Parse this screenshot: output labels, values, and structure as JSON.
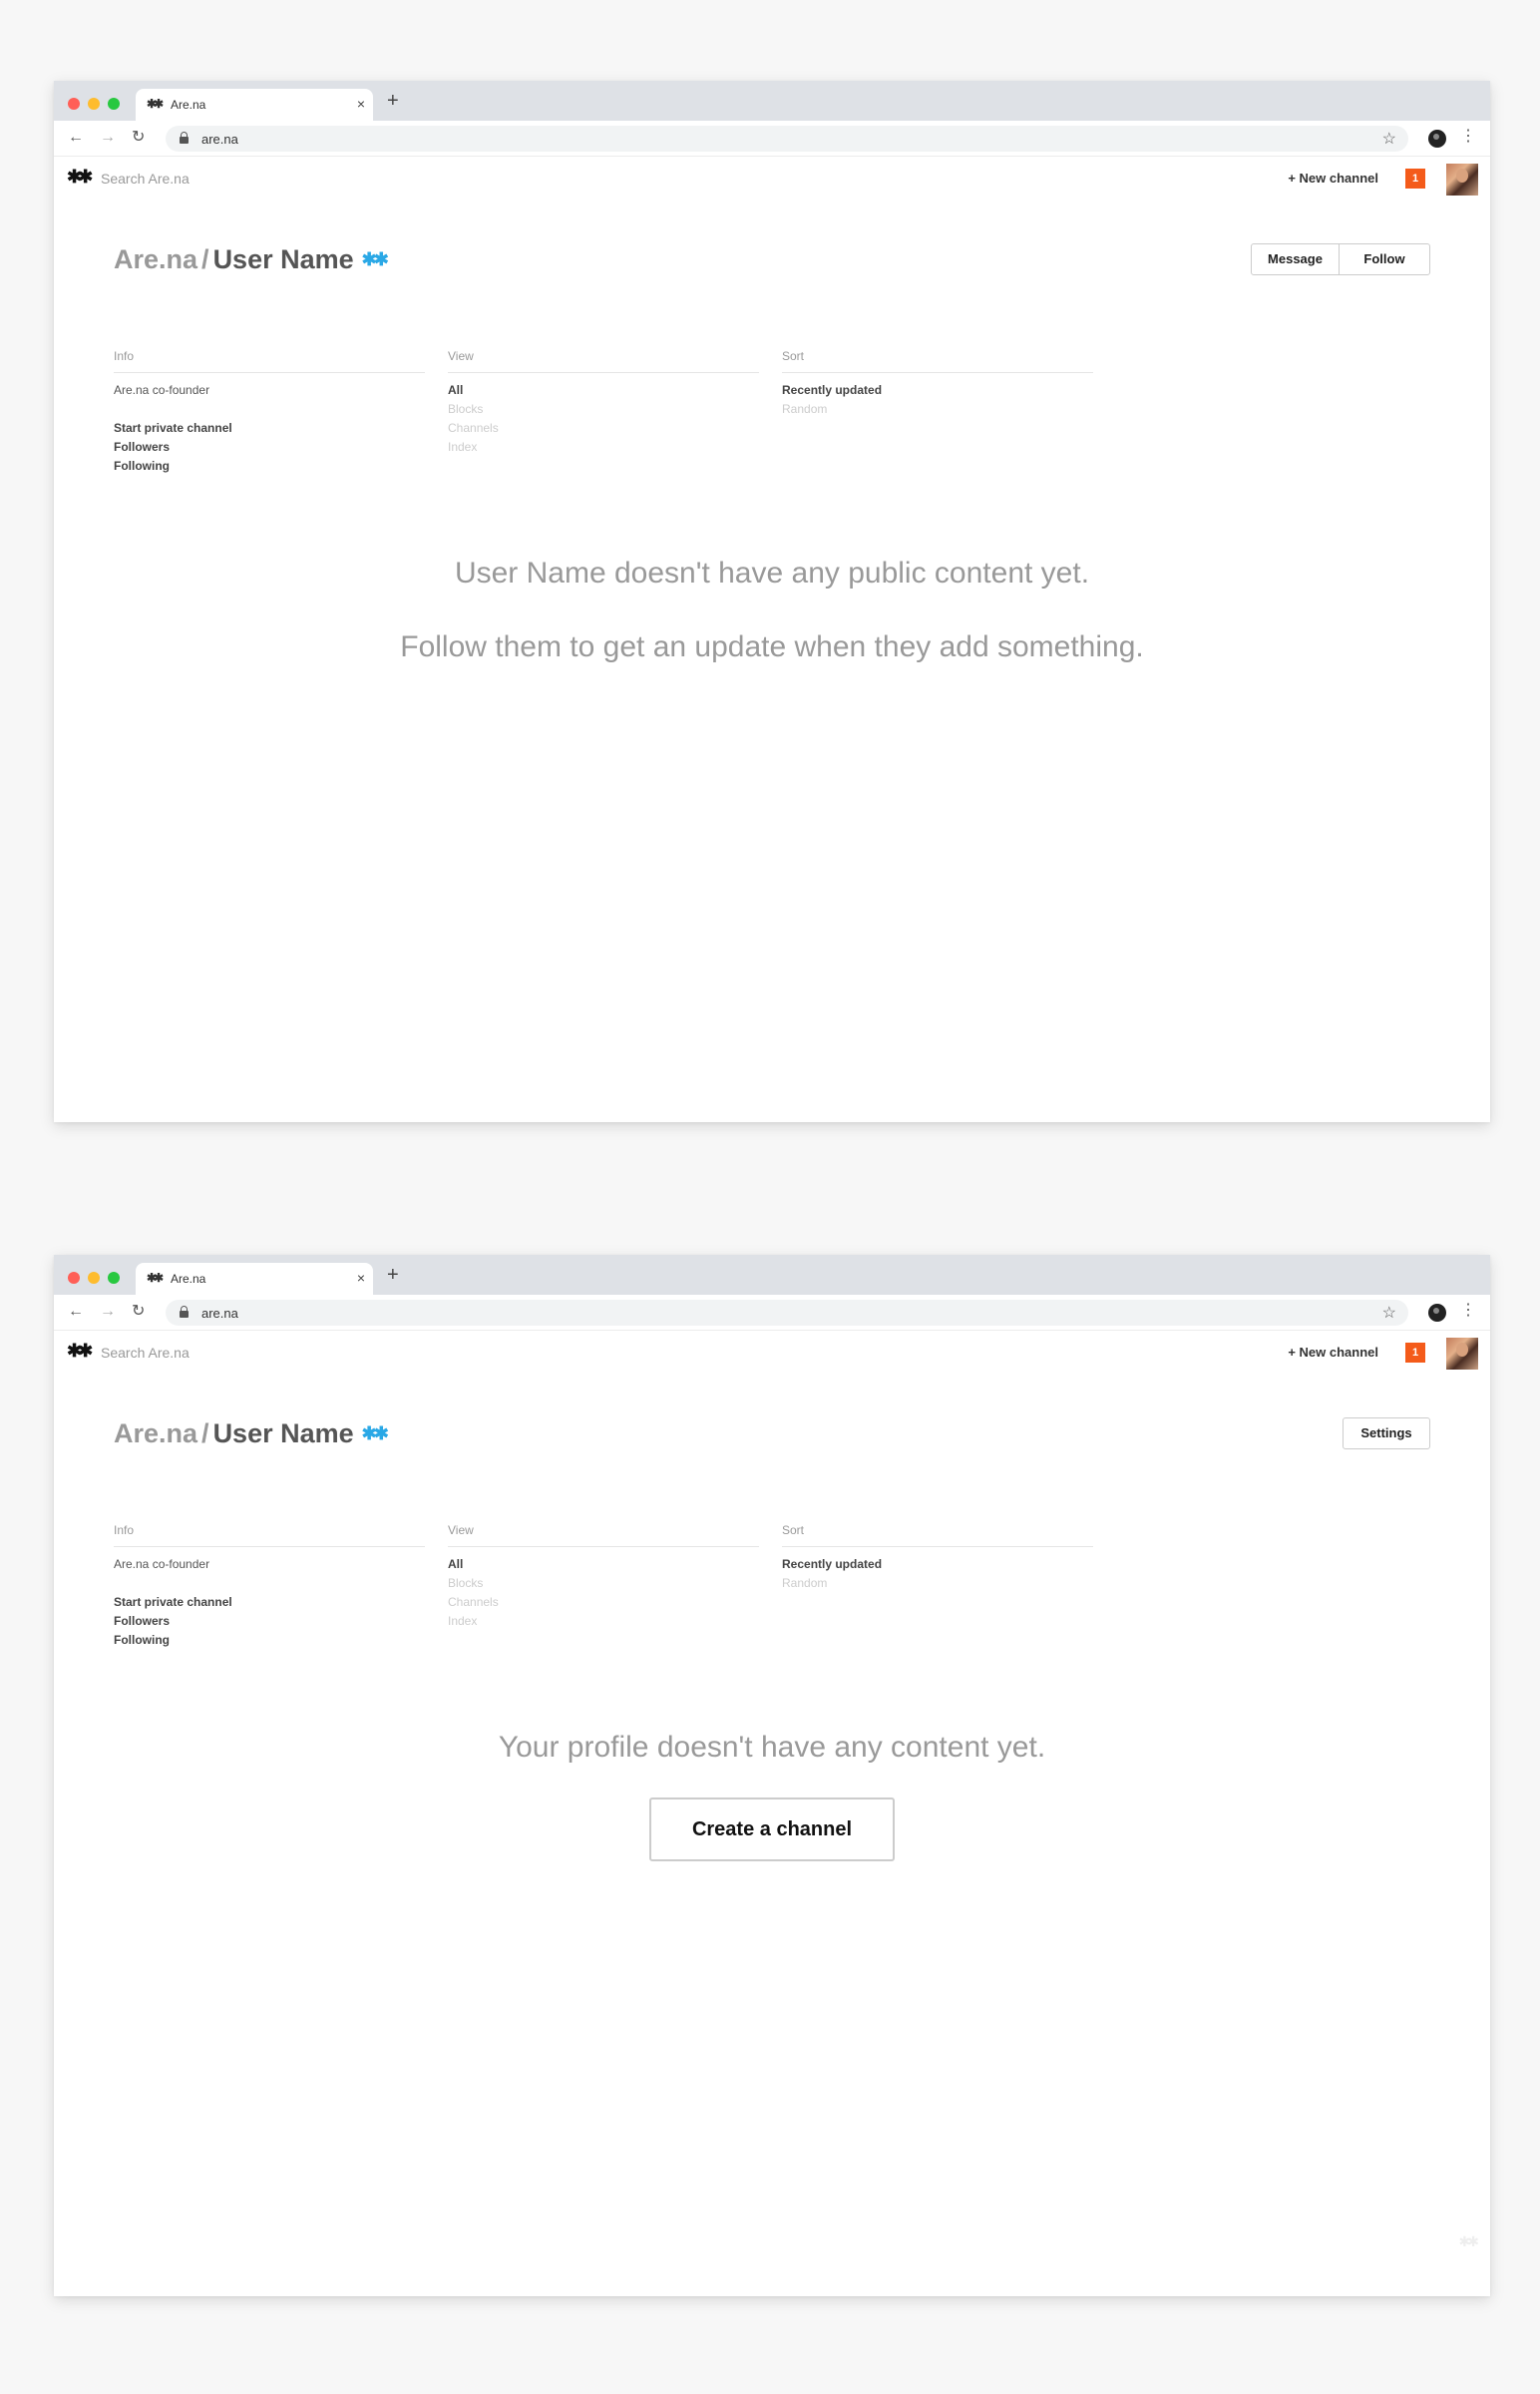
{
  "browser": {
    "tab_icon": "✱✱",
    "tab_title": "Are.na",
    "tab_close": "×",
    "new_tab": "+",
    "url": "are.na",
    "back_icon": "←",
    "forward_icon": "→",
    "reload_icon": "↻",
    "star_icon": "☆",
    "menu_icon": "⋮"
  },
  "appbar": {
    "logo": "✱✱",
    "search_placeholder": "Search Are.na",
    "new_channel_label": "+ New channel",
    "notification_count": "1",
    "accent_color": "#f45b1a"
  },
  "profile": {
    "site": "Are.na",
    "separator": "/",
    "user_name": "User Name",
    "verified_icon": "✱✱",
    "verified_color": "#2aa8e6",
    "info": {
      "heading": "Info",
      "bio": "Are.na co-founder",
      "links": [
        "Start private channel",
        "Followers",
        "Following"
      ]
    },
    "view": {
      "heading": "View",
      "options": [
        "All",
        "Blocks",
        "Channels",
        "Index"
      ],
      "selected": "All"
    },
    "sort": {
      "heading": "Sort",
      "options": [
        "Recently updated",
        "Random"
      ],
      "selected": "Recently updated"
    }
  },
  "screen1": {
    "buttons": {
      "message": "Message",
      "follow": "Follow"
    },
    "empty_line1": "User Name doesn't have any public content yet.",
    "empty_line2": "Follow them to get an update when they add something."
  },
  "screen2": {
    "buttons": {
      "settings": "Settings"
    },
    "empty_line1": "Your profile doesn't have any content yet.",
    "create_channel_label": "Create a channel",
    "corner_mark": "✱✱"
  }
}
